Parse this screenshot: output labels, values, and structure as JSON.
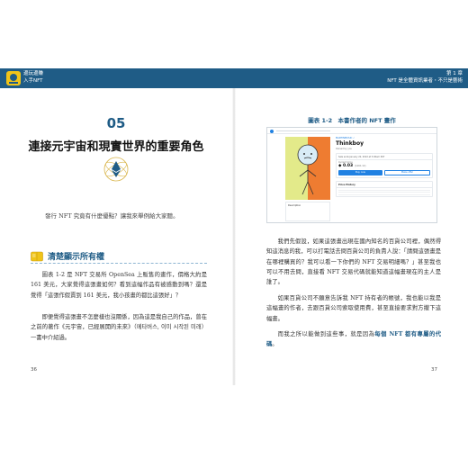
{
  "header": {
    "book_line1": "邊玩邊賺",
    "book_line2": "入手NFT",
    "chapter_line1": "第 1 章",
    "chapter_line2": "NFT 是全體資訊業者・不只是藝術",
    "brand_color": "#1f5c86"
  },
  "left_page": {
    "chapter_number": "05",
    "chapter_title": "連接元宇宙和現實世界的重要角色",
    "icon": "ethereum-icon",
    "lead": "發行 NFT 究竟有什麼優點？讓我來舉例給大家聽。",
    "section_icon": "book-icon",
    "section_title": "清楚顯示所有權",
    "para1": "圖表 1-2 是 NFT 交易所 OpenSea 上販售的畫作，價格大約是 161 美元，大家覺得這張畫如何？看到這幅作品有被感動到嗎？還是覺得「這張作假賣到 161 美元，我小孩畫的都比這張好」？",
    "para2": "即便覺得這張畫不怎麼樣也沒關係，因為這是我自己的作品，曾在之前的著作《元宇宙，已經展開的未來》（메타버스, 이미 시작된 미래）一書中介紹過。",
    "page_number": "36"
  },
  "right_page": {
    "figure_number": "圖表 1-2",
    "figure_caption": "本書作者的 NFT 畫作",
    "screenshot": {
      "collection": "MARTINMUSIC ✓",
      "nft_name": "Thinkboy",
      "owner": "Owned by you",
      "sale_line": "Sale ends January 22, 2022 at 3:00am KST",
      "price_label": "Current price",
      "price": "◆ 0.03",
      "price_usd": "($161.12)",
      "buy_label": "Buy now",
      "offer_label": "Make offer",
      "history_label": "Price History",
      "meta_label": "Description",
      "accent_color": "#2081e2"
    },
    "para1": "我們先假設，如果這張畫出現在國內知名的百貨公司裡，偶然得知這消息的我，可以打電話去問百貨公司的負責人說：「請問這張畫是在哪裡購買的？我可以看一下你們的 NFT 交易明細嗎？」甚至我也可以不用去問，直接看 NFT 交易代碼就能知道這幅畫現在的主人是誰了。",
    "para2": "如果百貨公司不願意告訴我 NFT 持有者的帳號，我也能以我是這幅畫的作者，去跟百貨公司索取使用費，甚至直接要求對方撤下這幅畫。",
    "para3_before": "而我之所以能做到這些事，就是因為",
    "para3_emph": "每個 NFT 都有專屬的代碼",
    "para3_after": "。",
    "page_number": "37"
  }
}
